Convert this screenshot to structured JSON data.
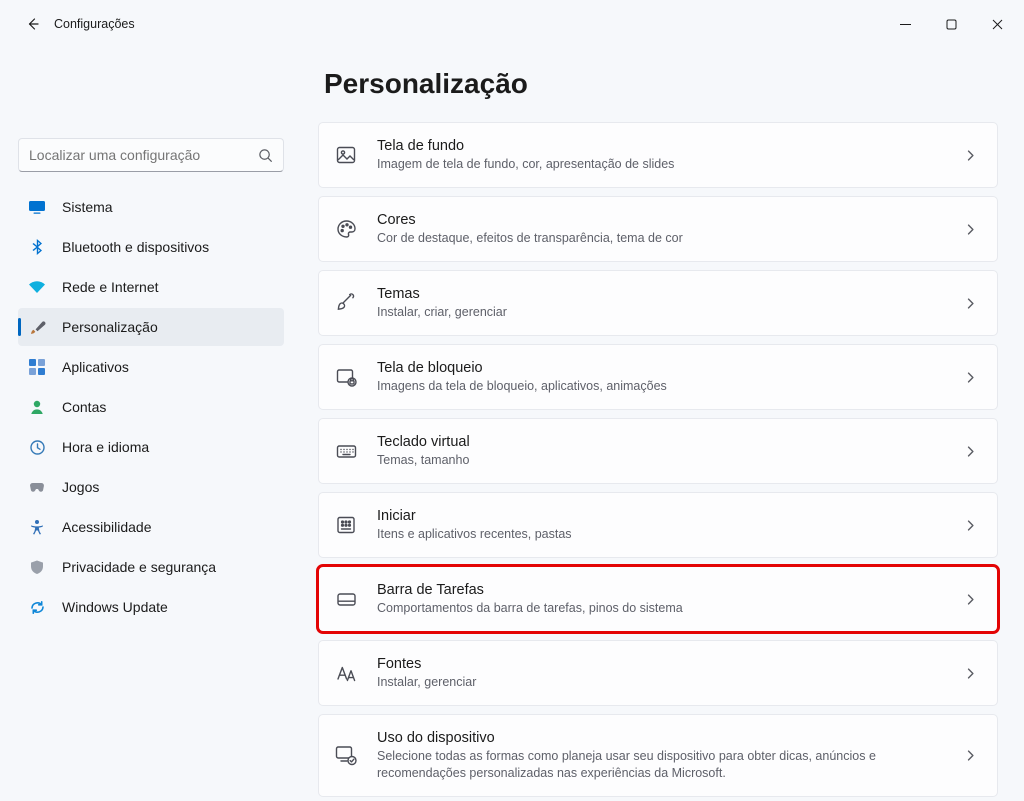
{
  "window": {
    "title": "Configurações"
  },
  "search": {
    "placeholder": "Localizar uma configuração"
  },
  "nav": [
    {
      "id": "system",
      "label": "Sistema"
    },
    {
      "id": "bluetooth",
      "label": "Bluetooth e dispositivos"
    },
    {
      "id": "network",
      "label": "Rede e Internet"
    },
    {
      "id": "personalization",
      "label": "Personalização",
      "active": true
    },
    {
      "id": "apps",
      "label": "Aplicativos"
    },
    {
      "id": "accounts",
      "label": "Contas"
    },
    {
      "id": "time",
      "label": "Hora e idioma"
    },
    {
      "id": "gaming",
      "label": "Jogos"
    },
    {
      "id": "accessibility",
      "label": "Acessibilidade"
    },
    {
      "id": "privacy",
      "label": "Privacidade e segurança"
    },
    {
      "id": "update",
      "label": "Windows Update"
    }
  ],
  "page": {
    "heading": "Personalização"
  },
  "cards": [
    {
      "id": "background",
      "title": "Tela de fundo",
      "sub": "Imagem de tela de fundo, cor, apresentação de slides"
    },
    {
      "id": "colors",
      "title": "Cores",
      "sub": "Cor de destaque, efeitos de transparência, tema de cor"
    },
    {
      "id": "themes",
      "title": "Temas",
      "sub": "Instalar, criar, gerenciar"
    },
    {
      "id": "lockscreen",
      "title": "Tela de bloqueio",
      "sub": "Imagens da tela de bloqueio, aplicativos, animações"
    },
    {
      "id": "touchkeyboard",
      "title": "Teclado virtual",
      "sub": "Temas, tamanho"
    },
    {
      "id": "start",
      "title": "Iniciar",
      "sub": "Itens e aplicativos recentes, pastas"
    },
    {
      "id": "taskbar",
      "title": "Barra de Tarefas",
      "sub": "Comportamentos da barra de tarefas, pinos do sistema",
      "highlight": true
    },
    {
      "id": "fonts",
      "title": "Fontes",
      "sub": "Instalar, gerenciar"
    },
    {
      "id": "deviceusage",
      "title": "Uso do dispositivo",
      "sub": "Selecione todas as formas como planeja usar seu dispositivo para obter dicas, anúncios e recomendações personalizadas nas experiências da Microsoft."
    }
  ]
}
